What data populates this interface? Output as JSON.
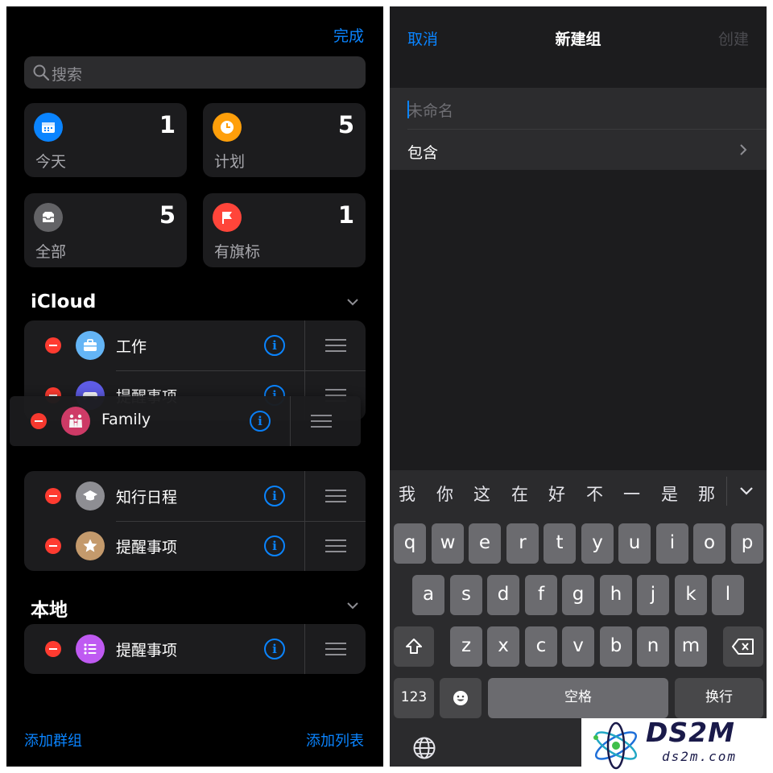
{
  "left": {
    "done_label": "完成",
    "search_placeholder": "搜索",
    "smart_lists": [
      {
        "label": "今天",
        "count": "1",
        "color": "#0a84ff",
        "icon": "calendar-icon"
      },
      {
        "label": "计划",
        "count": "5",
        "color": "#ff9f0a",
        "icon": "clock-icon"
      },
      {
        "label": "全部",
        "count": "5",
        "color": "#636366",
        "icon": "tray-icon"
      },
      {
        "label": "有旗标",
        "count": "1",
        "color": "#ff453a",
        "icon": "flag-icon"
      }
    ],
    "icloud_title": "iCloud",
    "icloud_lists": [
      {
        "name": "工作",
        "color": "#64b5f6",
        "icon": "briefcase-icon"
      },
      {
        "name": "提醒事项",
        "color": "#5e5ce6",
        "icon": "gamepad-icon"
      },
      {
        "name": "知行日程",
        "color": "#8e8e93",
        "icon": "graduation-cap-icon"
      },
      {
        "name": "提醒事项",
        "color": "#c49a6c",
        "icon": "star-icon"
      }
    ],
    "dragging_list": {
      "name": "Family",
      "color": "#d63d6b",
      "icon": "family-icon"
    },
    "local_title": "本地",
    "local_lists": [
      {
        "name": "提醒事项",
        "color": "#bf5af2",
        "icon": "list-icon"
      }
    ],
    "add_group_label": "添加群组",
    "add_list_label": "添加列表"
  },
  "right": {
    "cancel_label": "取消",
    "title": "新建组",
    "create_label": "创建",
    "name_placeholder": "未命名",
    "include_label": "包含",
    "candidates": [
      "我",
      "你",
      "这",
      "在",
      "好",
      "不",
      "一",
      "是",
      "那"
    ],
    "row1": [
      "q",
      "w",
      "e",
      "r",
      "t",
      "y",
      "u",
      "i",
      "o",
      "p"
    ],
    "row2": [
      "a",
      "s",
      "d",
      "f",
      "g",
      "h",
      "j",
      "k",
      "l"
    ],
    "row3": [
      "z",
      "x",
      "c",
      "v",
      "b",
      "n",
      "m"
    ],
    "num_label": "123",
    "space_label": "空格",
    "return_label": "换行"
  },
  "watermark": {
    "brand": "DS2M",
    "domain": "ds2m.com"
  },
  "colors": {
    "accent": "#0a84ff",
    "delete": "#ff3b30"
  }
}
